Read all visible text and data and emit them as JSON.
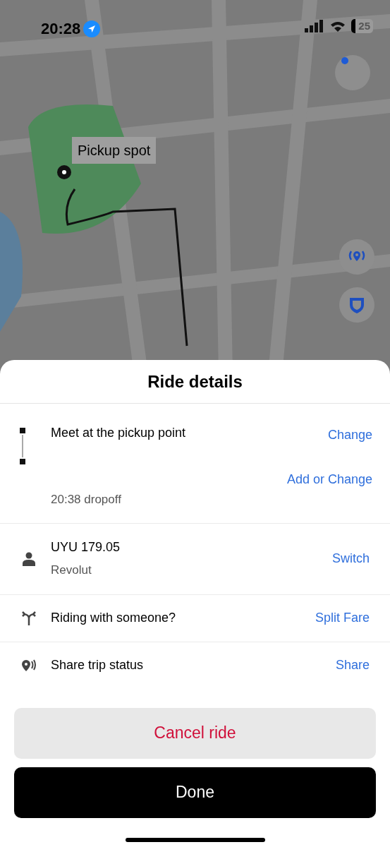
{
  "status_bar": {
    "time": "20:28",
    "battery": "25"
  },
  "map": {
    "pickup_label": "Pickup spot"
  },
  "sheet": {
    "title": "Ride details",
    "trip": {
      "pickup": "Meet at the pickup point",
      "pickup_action": "Change",
      "dropoff": "20:38 dropoff",
      "dropoff_action": "Add or Change"
    },
    "rows": [
      {
        "kind": "payment",
        "title": "UYU 179.05",
        "subtitle": "Revolut",
        "action": "Switch"
      },
      {
        "kind": "split",
        "title": "Riding with someone?",
        "action": "Split Fare"
      },
      {
        "kind": "share",
        "title": "Share trip status",
        "action": "Share"
      }
    ],
    "buttons": [
      {
        "kind": "secondary",
        "label": "Cancel ride"
      },
      {
        "kind": "primary",
        "label": "Done"
      }
    ]
  }
}
